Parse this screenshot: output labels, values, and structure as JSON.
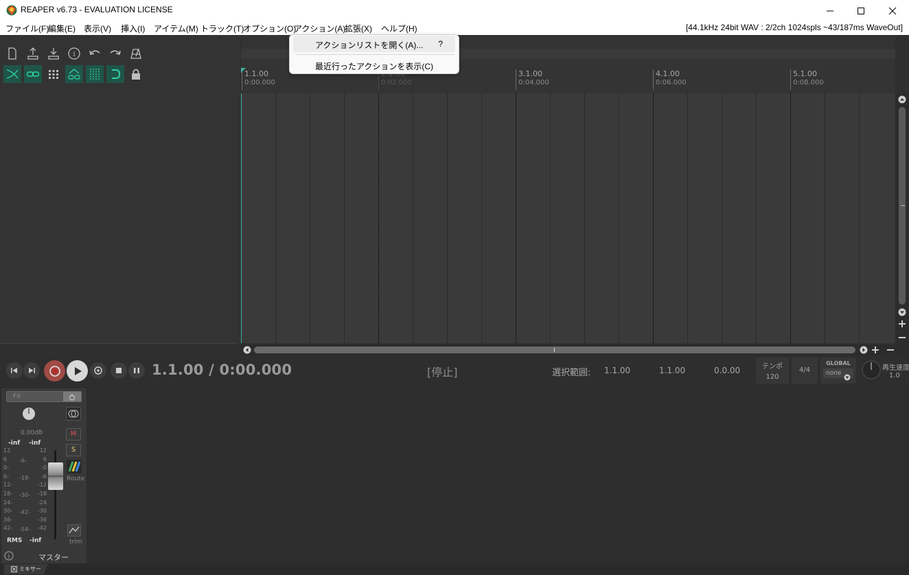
{
  "window": {
    "title": "REAPER v6.73 - EVALUATION LICENSE"
  },
  "menubar": {
    "items": [
      "ファイル(F)",
      "編集(E)",
      "表示(V)",
      "挿入(I)",
      "アイテム(M)",
      "トラック(T)",
      "オプション(O)",
      "アクション(A)",
      "拡張(X)",
      "ヘルプ(H)"
    ],
    "status": "[44.1kHz 24bit WAV : 2/2ch 1024spls ~43/187ms WaveOut]"
  },
  "dropdown": {
    "items": [
      {
        "label": "アクションリストを開く(A)...",
        "shortcut": "?"
      },
      {
        "label": "最近行ったアクションを表示(C)",
        "shortcut": ""
      }
    ]
  },
  "ruler": {
    "marks": [
      {
        "bar": "1.1.00",
        "time": "0:00.000"
      },
      {
        "bar": "2.1.00",
        "time": "0:02.000"
      },
      {
        "bar": "3.1.00",
        "time": "0:04.000"
      },
      {
        "bar": "4.1.00",
        "time": "0:06.000"
      },
      {
        "bar": "5.1.00",
        "time": "0:08.000"
      }
    ]
  },
  "transport": {
    "position": "1.1.00 / 0:00.000",
    "state": "[停止]",
    "selection_label": "選択範囲:",
    "sel_start": "1.1.00",
    "sel_end": "1.1.00",
    "sel_length": "0.0.00",
    "tempo_label": "テンポ",
    "tempo": "120",
    "time_sig": "4/4",
    "global_label": "GLOBAL",
    "global_value": "none",
    "rate_label": "再生速度",
    "rate": "1.0"
  },
  "master": {
    "fx_label": "FX",
    "volume": "0.00dB",
    "peak_l": "-inf",
    "peak_r": "-inf",
    "mute": "M",
    "solo": "S",
    "route": "Route",
    "trim": "trim",
    "rms_label": "RMS",
    "rms_value": "-inf",
    "name": "マスター",
    "scale_left": [
      "12",
      "6",
      "0-",
      "6-",
      "12-",
      "18-",
      "24-",
      "30-",
      "36-",
      "42-"
    ],
    "scale_mid": [
      "-6-",
      "-18-",
      "-30-",
      "-42-",
      "-54-"
    ],
    "scale_right": [
      "12",
      "6",
      "-0",
      "-6",
      "-12",
      "-18",
      "-24",
      "-30",
      "-36",
      "-42"
    ]
  },
  "mixer_tab": {
    "label": "ミキサー"
  }
}
